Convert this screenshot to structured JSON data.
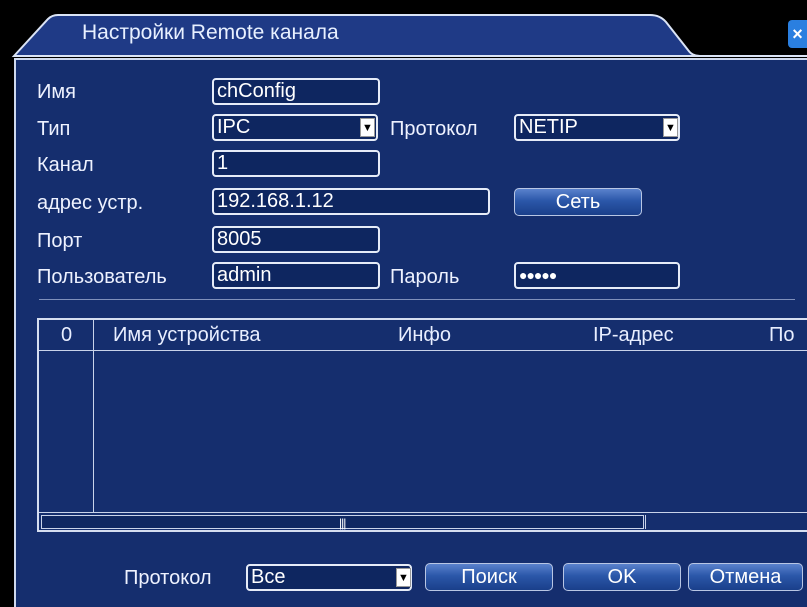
{
  "window": {
    "title": "Настройки Remote канала",
    "close_glyph": "×"
  },
  "form": {
    "name_label": "Имя",
    "name_value": "chConfig",
    "type_label": "Тип",
    "type_value": "IPC",
    "protocol_label": "Протокол",
    "protocol_value": "NETIP",
    "channel_label": "Канал",
    "channel_value": "1",
    "address_label": "адрес устр.",
    "address_value": "192.168.1.12",
    "network_button": "Сеть",
    "port_label": "Порт",
    "port_value": "8005",
    "user_label": "Пользователь",
    "user_value": "admin",
    "password_label": "Пароль",
    "password_value": "●●●●●"
  },
  "table": {
    "columns": [
      "0",
      "Имя устройства",
      "Инфо",
      "IP-адрес",
      "По"
    ],
    "rows": [],
    "scroll_grip": "|||"
  },
  "footer": {
    "protocol_label": "Протокол",
    "protocol_value": "Все",
    "search_button": "Поиск",
    "ok_button": "OK",
    "cancel_button": "Отмена"
  },
  "icons": {
    "dropdown_arrow": "▼"
  },
  "colors": {
    "panel": "#152e6e",
    "titlebar": "#1f3a86",
    "accent": "#2a7fe0"
  }
}
